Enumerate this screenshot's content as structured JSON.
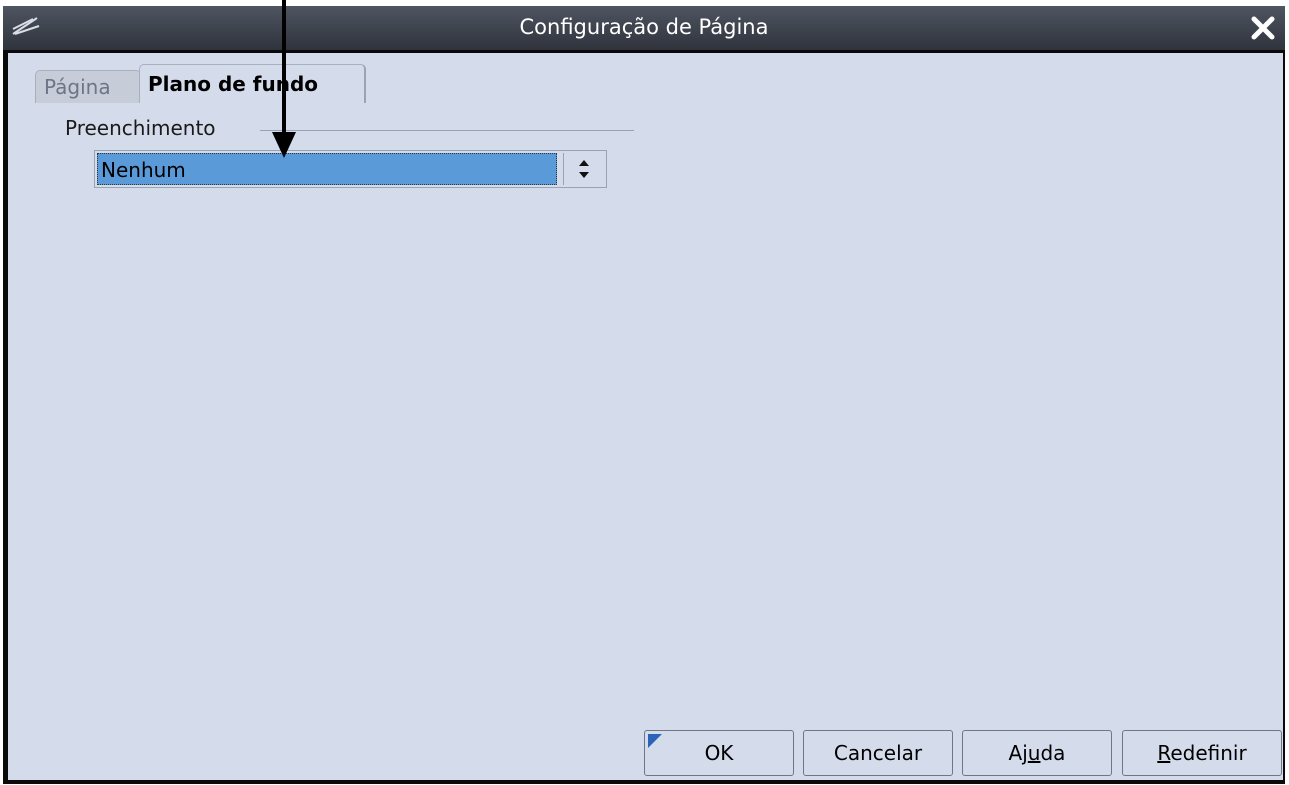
{
  "window": {
    "title": "Configuração de Página"
  },
  "tabs": [
    {
      "label": "Página",
      "active": false
    },
    {
      "label": "Plano de fundo",
      "active": true
    }
  ],
  "fill_group": {
    "label": "Preenchimento",
    "select": {
      "value": "Nenhum"
    }
  },
  "buttons": {
    "ok": "OK",
    "cancel": "Cancelar",
    "help_pre": "Aj",
    "help_u": "u",
    "help_post": "da",
    "reset_u": "R",
    "reset_post": "edefinir"
  },
  "colors": {
    "titlebar": "#3a3f48",
    "client_bg": "#d4dcec",
    "selection": "#5a9ad8",
    "annotation_arrow": "#000000"
  },
  "icons": {
    "app": "app-icon",
    "close": "close-icon",
    "spin": "spin-updown-icon",
    "annotation": "annotation-arrow"
  }
}
